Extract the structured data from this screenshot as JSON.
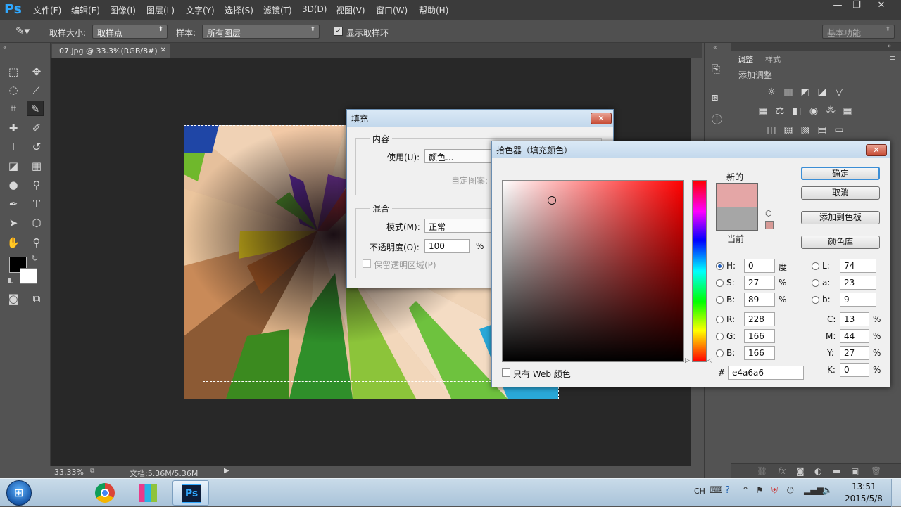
{
  "app": {
    "logo": "Ps"
  },
  "menu": [
    "文件(F)",
    "编辑(E)",
    "图像(I)",
    "图层(L)",
    "文字(Y)",
    "选择(S)",
    "滤镜(T)",
    "3D(D)",
    "视图(V)",
    "窗口(W)",
    "帮助(H)"
  ],
  "window_controls": {
    "minimize": "—",
    "restore": "❐",
    "close": "✕"
  },
  "options_bar": {
    "sample_size_label": "取样大小:",
    "sample_size_value": "取样点",
    "sample_label": "样本:",
    "sample_value": "所有图层",
    "show_ring_label": "显示取样环",
    "workspace": "基本功能"
  },
  "document": {
    "tab_title": "07.jpg @ 33.3%(RGB/8#)",
    "tab_close": "✕"
  },
  "status": {
    "zoom": "33.33%",
    "doc_size": "文档:5.36M/5.36M"
  },
  "right_panel": {
    "tab_adjust": "调整",
    "tab_style": "样式",
    "heading": "添加调整"
  },
  "fill_dialog": {
    "title": "填充",
    "content_group": "内容",
    "use_label": "使用(U):",
    "use_value": "颜色...",
    "custom_pattern_label": "自定图案:",
    "blend_group": "混合",
    "mode_label": "模式(M):",
    "mode_value": "正常",
    "opacity_label": "不透明度(O):",
    "opacity_value": "100",
    "opacity_unit": "%",
    "preserve_label": "保留透明区域(P)"
  },
  "color_picker": {
    "title": "拾色器（填充颜色）",
    "new_label": "新的",
    "current_label": "当前",
    "new_color": "#e4a6a6",
    "current_color": "#a6a6a6",
    "buttons": {
      "ok": "确定",
      "cancel": "取消",
      "add_swatch": "添加到色板",
      "color_library": "颜色库"
    },
    "hsb": {
      "H": "0",
      "H_unit": "度",
      "S": "27",
      "S_unit": "%",
      "B": "89",
      "B_unit": "%"
    },
    "rgb": {
      "R": "228",
      "G": "166",
      "B": "166"
    },
    "lab": {
      "L": "74",
      "a": "23",
      "b": "9"
    },
    "cmyk": {
      "C": "13",
      "M": "44",
      "Y": "27",
      "K": "0",
      "unit": "%"
    },
    "hex_label": "#",
    "hex": "e4a6a6",
    "web_only_label": "只有 Web 颜色",
    "labels": {
      "H": "H:",
      "S": "S:",
      "B": "B:",
      "R": "R:",
      "G": "G:",
      "B2": "B:",
      "L": "L:",
      "a": "a:",
      "b": "b:",
      "C": "C:",
      "M": "M:",
      "Y": "Y:",
      "K": "K:"
    }
  },
  "taskbar": {
    "time": "13:51",
    "date": "2015/5/8",
    "lang": "CH"
  }
}
